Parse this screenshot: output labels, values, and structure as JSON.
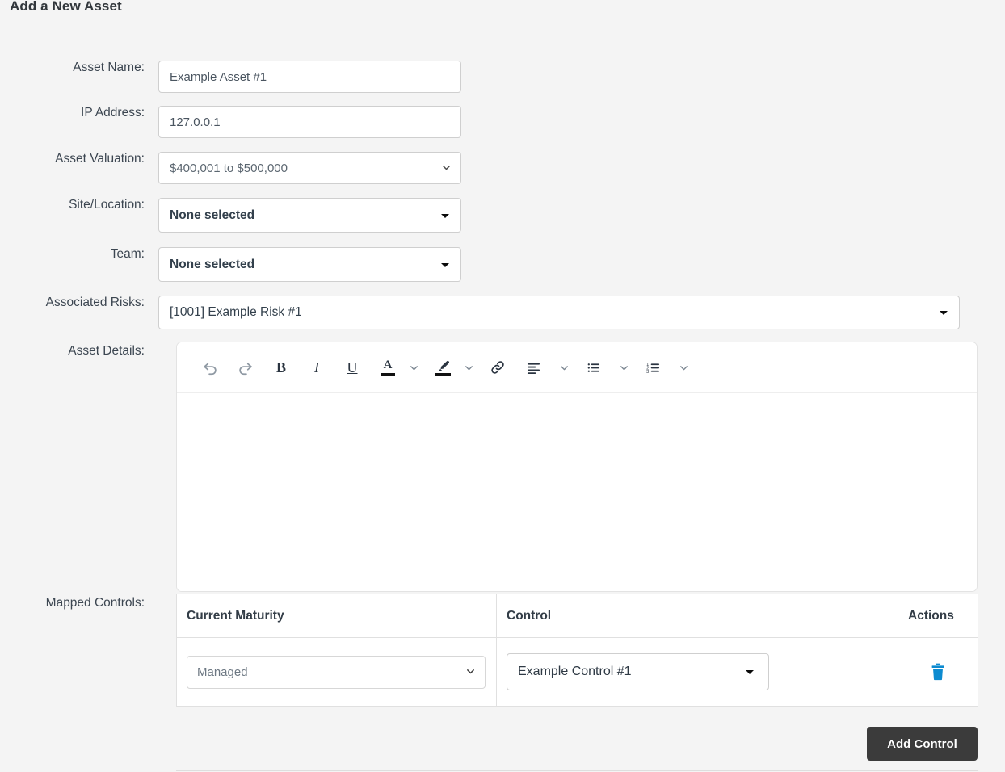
{
  "page": {
    "title": "Add a New Asset"
  },
  "form": {
    "asset_name": {
      "label": "Asset Name:",
      "value": "Example Asset #1",
      "placeholder": ""
    },
    "ip_address": {
      "label": "IP Address:",
      "value": "127.0.0.1",
      "placeholder": ""
    },
    "asset_valuation": {
      "label": "Asset Valuation:",
      "value": "$400,001 to $500,000",
      "options": [
        "$400,001 to $500,000"
      ]
    },
    "site_location": {
      "label": "Site/Location:",
      "value": "None selected"
    },
    "team": {
      "label": "Team:",
      "value": "None selected"
    },
    "associated_risks": {
      "label": "Associated Risks:",
      "value": "[1001] Example Risk #1"
    },
    "asset_details": {
      "label": "Asset Details:",
      "content": "",
      "toolbar": [
        {
          "name": "undo-icon",
          "title": "Undo"
        },
        {
          "name": "redo-icon",
          "title": "Redo"
        },
        {
          "name": "bold-icon",
          "title": "Bold",
          "glyph": "B"
        },
        {
          "name": "italic-icon",
          "title": "Italic",
          "glyph": "I"
        },
        {
          "name": "underline-icon",
          "title": "Underline",
          "glyph": "U"
        },
        {
          "name": "text-color-icon",
          "title": "Text color",
          "glyph": "A"
        },
        {
          "name": "text-color-chevron-down-icon",
          "title": "Text color options"
        },
        {
          "name": "highlight-icon",
          "title": "Highlight"
        },
        {
          "name": "highlight-chevron-down-icon",
          "title": "Highlight options"
        },
        {
          "name": "link-icon",
          "title": "Insert link"
        },
        {
          "name": "align-left-icon",
          "title": "Alignment"
        },
        {
          "name": "align-chevron-down-icon",
          "title": "Alignment options"
        },
        {
          "name": "bulleted-list-icon",
          "title": "Bulleted list"
        },
        {
          "name": "bulleted-list-chevron-down-icon",
          "title": "Bulleted list options"
        },
        {
          "name": "numbered-list-icon",
          "title": "Numbered list"
        },
        {
          "name": "numbered-list-chevron-down-icon",
          "title": "Numbered list options"
        }
      ]
    },
    "mapped_controls": {
      "label": "Mapped Controls:",
      "columns": [
        "Current Maturity",
        "Control",
        "Actions"
      ],
      "rows": [
        {
          "maturity": "Managed",
          "control": "Example Control #1",
          "action_icon": "trash-icon"
        }
      ],
      "add_button": "Add Control"
    }
  },
  "colors": {
    "background": "#f4f4f4",
    "title": "#32373c",
    "label": "#3c4651",
    "input_border": "#cfcfcf",
    "accent_blue": "#0d8bd0",
    "button_dark": "#3b3b3b"
  }
}
